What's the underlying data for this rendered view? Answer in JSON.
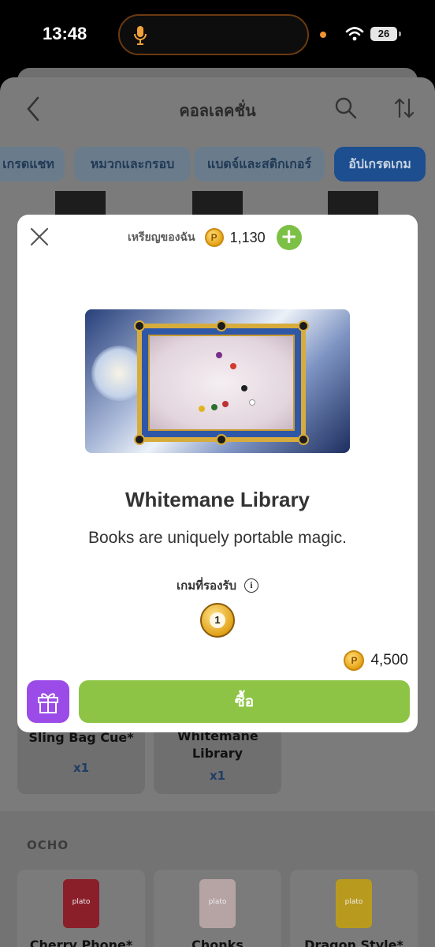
{
  "status_bar": {
    "time": "13:48",
    "battery": "26"
  },
  "header": {
    "title": "คอลเลคชั่น"
  },
  "chips": [
    {
      "label": "เกรดแชท",
      "active": false
    },
    {
      "label": "หมวกและกรอบ",
      "active": false
    },
    {
      "label": "แบดจ์และสติกเกอร์",
      "active": false
    },
    {
      "label": "อัปเกรดเกม",
      "active": true
    }
  ],
  "background_cards": [
    {
      "name": "Sling Bag Cue*",
      "qty": "x1"
    },
    {
      "name": "Whitemane Library",
      "qty": "x1"
    }
  ],
  "section": {
    "title": "OCHO",
    "products": [
      {
        "name": "Cherry Phone*",
        "brand": "plato"
      },
      {
        "name": "Chonks",
        "brand": "plato"
      },
      {
        "name": "Dragon Style*",
        "brand": "plato"
      }
    ]
  },
  "modal": {
    "my_coins_label": "เหรียญของฉัน",
    "my_coins_value": "1,130",
    "coin_symbol": "P",
    "add_symbol": "+",
    "item_title": "Whitemane Library",
    "item_description": "Books are uniquely portable magic.",
    "supported_games_label": "เกมที่รองรับ",
    "supported_game_number": "1",
    "price": "4,500",
    "buy_label": "ซื้อ"
  },
  "colors": {
    "buy_button": "#8dc445",
    "gift_button": "#9a4be8",
    "add_button": "#7dc046",
    "active_chip": "#1d4e8f",
    "coin": "#e6a316"
  },
  "icons": {
    "back": "chevron-left-icon",
    "search": "search-icon",
    "sort": "sort-icon",
    "close": "close-icon",
    "gift": "gift-icon",
    "info": "info-icon",
    "mic": "mic-icon",
    "wifi": "wifi-icon"
  }
}
